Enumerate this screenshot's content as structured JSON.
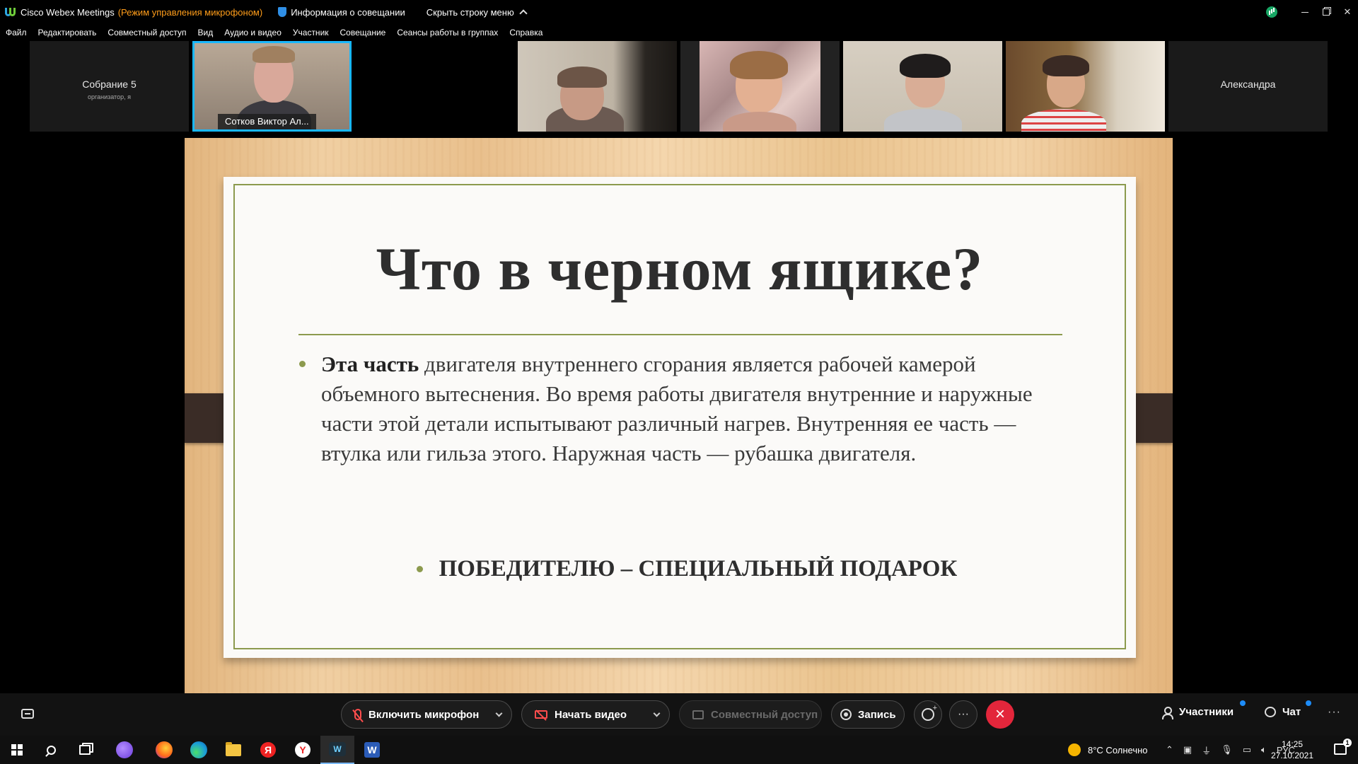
{
  "titlebar": {
    "app_name": "Cisco Webex Meetings",
    "mode": "(Режим управления микрофоном)",
    "meeting_info": "Информация о совещании",
    "hide_menu": "Скрыть строку меню"
  },
  "menu": [
    "Файл",
    "Редактировать",
    "Совместный доступ",
    "Вид",
    "Аудио и видео",
    "Участник",
    "Совещание",
    "Сеансы работы в группах",
    "Справка"
  ],
  "participants": {
    "host_tile": {
      "name": "Собрание 5",
      "role": "организатор, я"
    },
    "active_speaker": "Сотков Виктор Ал...",
    "last_tile": "Александра"
  },
  "slide": {
    "title": "Что в черном ящике?",
    "bold_lead": "Эта часть",
    "body": " двигателя внутреннего сгорания является рабочей камерой объемного вытеснения. Во время работы двигателя внутренние и наружные части этой детали испытывают различный нагрев. Внутренняя ее часть  — втулка или гильза этого. Наружная часть — рубашка двигателя.",
    "prize": "ПОБЕДИТЕЛЮ – СПЕЦИАЛЬНЫЙ ПОДАРОК"
  },
  "controls": {
    "mic": "Включить микрофон",
    "video": "Начать видео",
    "share": "Совместный доступ",
    "record": "Запись",
    "more": "···",
    "leave": "×",
    "participants": "Участники",
    "chat": "Чат",
    "overflow": "···"
  },
  "taskbar": {
    "weather": "8°C  Солнечно",
    "lang": "РУС",
    "time": "14:25",
    "date": "27.10.2021",
    "notifications": "1"
  },
  "colors": {
    "accent": "#19b8ff",
    "mode_text": "#ff9d1a",
    "leave": "#e3263b",
    "slide_rule": "#8c9a4e"
  }
}
